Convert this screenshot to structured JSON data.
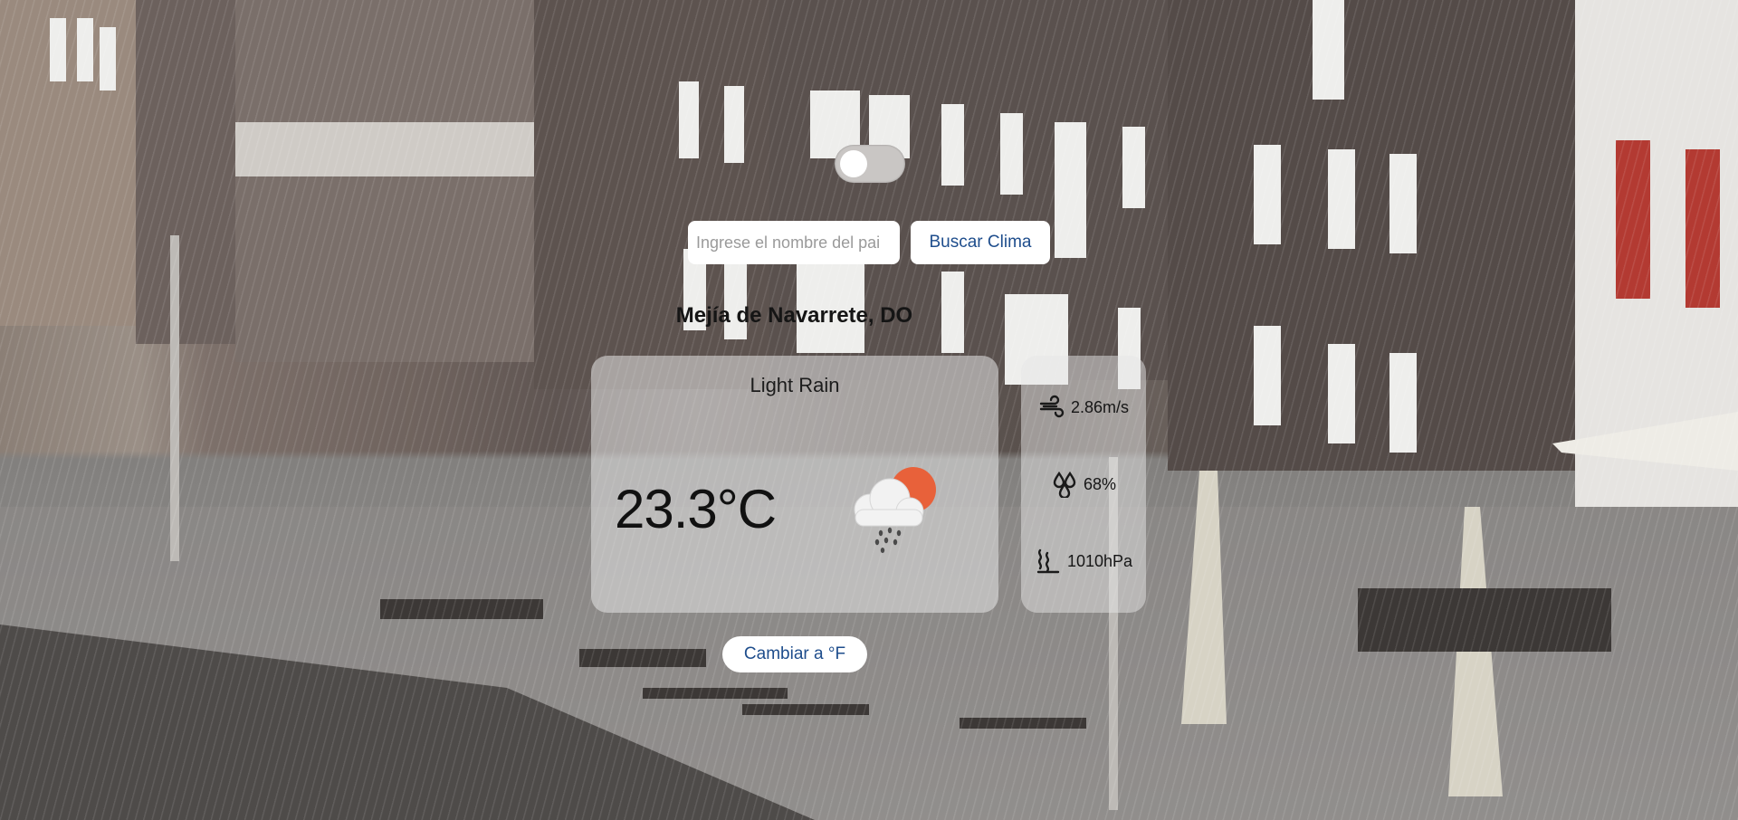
{
  "theme_toggle": {
    "state": "off"
  },
  "search": {
    "placeholder": "Ingrese el nombre del pai",
    "value": "",
    "button_label": "Buscar Clima"
  },
  "location": {
    "name": "Mejía de Navarrete, DO"
  },
  "weather": {
    "condition": "Light Rain",
    "temperature": "23.3°C",
    "icon": "rain-cloud-sun-icon"
  },
  "stats": {
    "wind": {
      "icon": "wind-icon",
      "value": "2.86m/s"
    },
    "humidity": {
      "icon": "humidity-icon",
      "value": "68%"
    },
    "pressure": {
      "icon": "pressure-icon",
      "value": "1010hPa"
    }
  },
  "unit_button": {
    "label": "Cambiar a °F"
  },
  "colors": {
    "accent": "#1e4d8c",
    "sun": "#e8613a",
    "card": "#e6e6e6"
  },
  "background": {
    "scene": "rainy-street-photo"
  }
}
